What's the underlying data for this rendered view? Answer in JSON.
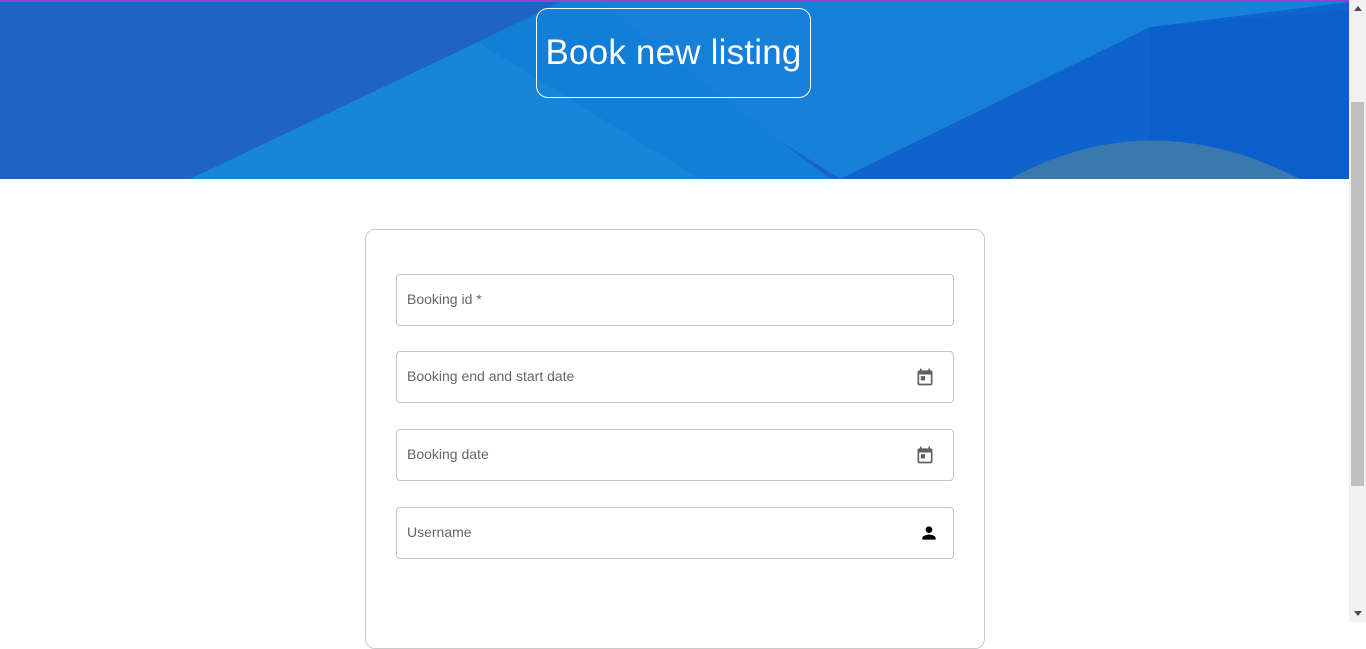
{
  "hero": {
    "title": "Book new listing"
  },
  "form": {
    "fields": [
      {
        "label": "Booking id *",
        "icon": "none"
      },
      {
        "label": "Booking end and start date",
        "icon": "calendar-icon"
      },
      {
        "label": "Booking date",
        "icon": "calendar-icon"
      },
      {
        "label": "Username",
        "icon": "person-icon"
      }
    ]
  },
  "colors": {
    "hero_blue": "#1a6fd0",
    "accent_purple": "#9b3fd0",
    "field_border": "#c4c4c4",
    "label_gray": "#666666"
  }
}
